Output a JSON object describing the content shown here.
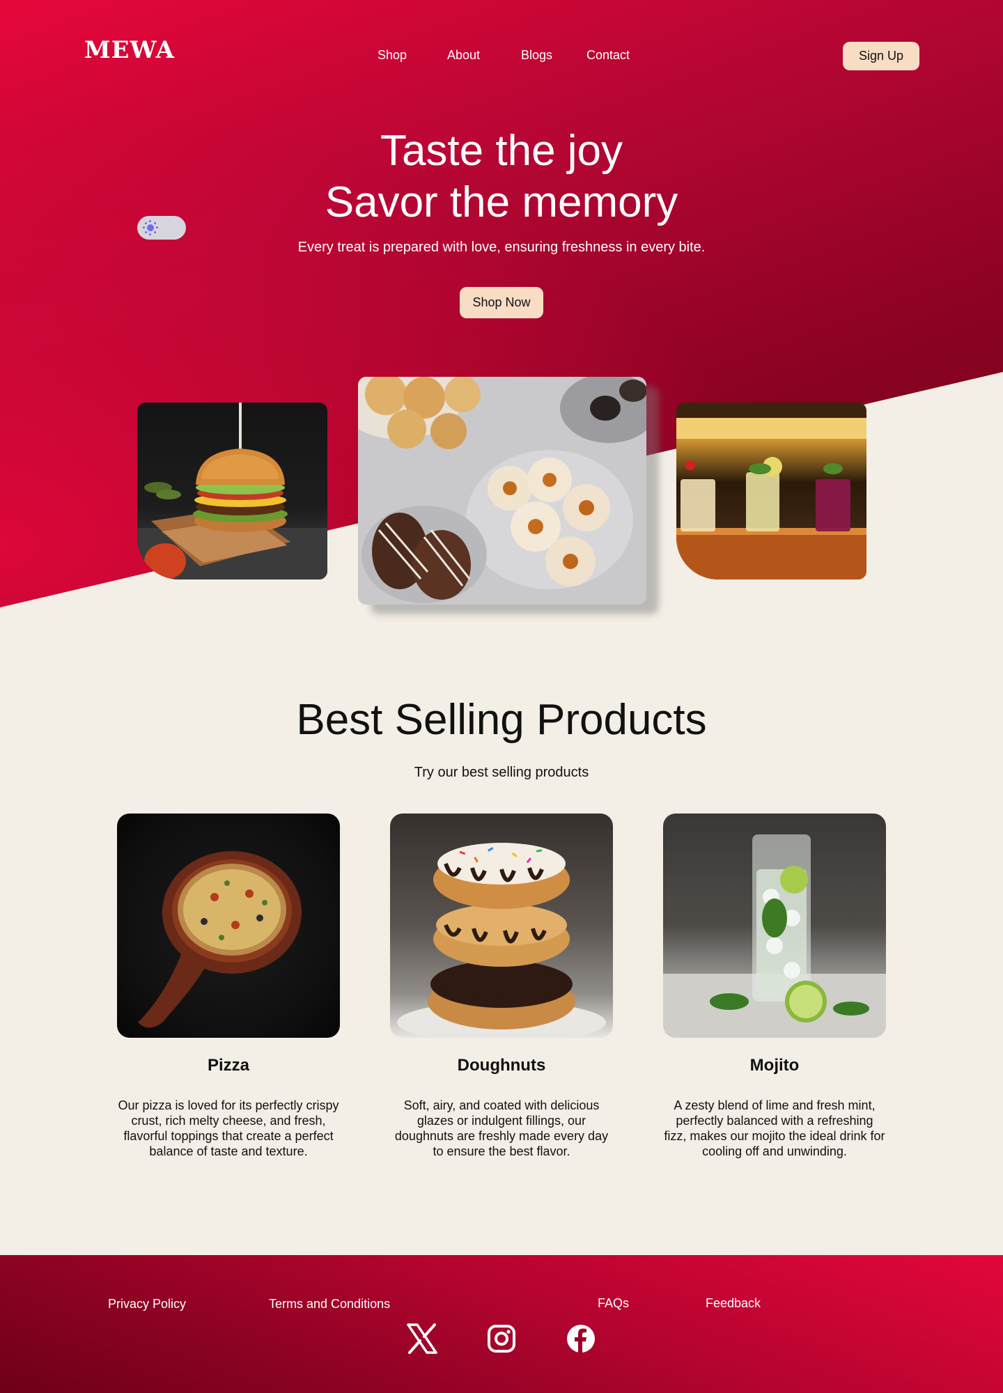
{
  "brand": {
    "logo": "MEWA"
  },
  "nav": {
    "items": [
      "Shop",
      "About",
      "Blogs",
      "Contact"
    ],
    "signup_label": "Sign Up"
  },
  "hero": {
    "title_line1": "Taste the joy",
    "title_line2": "Savor the memory",
    "subtitle": "Every treat is prepared with love, ensuring freshness in every bite.",
    "cta_label": "Shop Now",
    "theme_toggle": {
      "icon": "sun-icon",
      "state": "light"
    },
    "photos": [
      "burger-photo",
      "cookies-photo",
      "drinks-photo"
    ]
  },
  "best_selling": {
    "title": "Best Selling Products",
    "subtitle": "Try our best selling products",
    "products": [
      {
        "name": "Pizza",
        "description": "Our pizza is loved for its perfectly crispy crust, rich melty cheese, and fresh, flavorful toppings that create a perfect balance of taste and texture."
      },
      {
        "name": "Doughnuts",
        "description": "Soft, airy, and coated with delicious glazes or indulgent fillings, our doughnuts are freshly made every day to ensure the best flavor."
      },
      {
        "name": "Mojito",
        "description": "A zesty blend of lime and fresh mint, perfectly balanced with a refreshing fizz, makes our mojito the ideal drink for cooling off and unwinding."
      }
    ]
  },
  "footer": {
    "links": [
      "Privacy Policy",
      "Terms and Conditions",
      "FAQs",
      "Feedback"
    ],
    "social": [
      "x-icon",
      "instagram-icon",
      "facebook-icon"
    ]
  },
  "colors": {
    "primary": "#e6073a",
    "dark": "#6e0018",
    "accent": "#f8dcc4",
    "background": "#f3efe6"
  }
}
